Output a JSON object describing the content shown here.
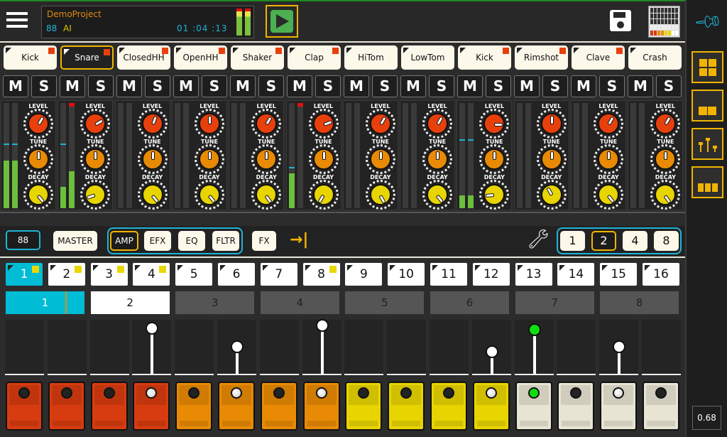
{
  "header": {
    "project": "DemoProject",
    "bpm": "88",
    "kit": "AI",
    "time": "01  :04  :13",
    "master_meter": [
      0.85,
      0.85
    ]
  },
  "tracks": [
    {
      "name": "Kick",
      "mark": true
    },
    {
      "name": "Snare",
      "mark": true,
      "selected": true
    },
    {
      "name": "ClosedHH",
      "mark": true
    },
    {
      "name": "OpenHH",
      "mark": true
    },
    {
      "name": "Shaker",
      "mark": true
    },
    {
      "name": "Clap",
      "mark": true
    },
    {
      "name": "HiTom",
      "mark": false
    },
    {
      "name": "LowTom",
      "mark": false
    },
    {
      "name": "Kick",
      "mark": true
    },
    {
      "name": "Rimshot",
      "mark": true
    },
    {
      "name": "Clave",
      "mark": true
    },
    {
      "name": "Crash",
      "mark": false
    }
  ],
  "mute_label": "M",
  "solo_label": "S",
  "knob_labels": [
    "LEVEL",
    "TUNE",
    "DECAY"
  ],
  "mixer": [
    {
      "meters": [
        0.45,
        0.45
      ],
      "peaks": [
        0.6,
        0.6
      ],
      "clip": false,
      "knobs": [
        30,
        0,
        140
      ]
    },
    {
      "meters": [
        0.2,
        0.35
      ],
      "peaks": [
        0.6,
        0.98
      ],
      "clip": true,
      "knobs": [
        60,
        0,
        -110
      ]
    },
    {
      "meters": [
        0,
        0
      ],
      "peaks": [
        null,
        null
      ],
      "clip": false,
      "knobs": [
        20,
        0,
        140
      ]
    },
    {
      "meters": [
        0,
        0
      ],
      "peaks": [
        null,
        null
      ],
      "clip": false,
      "knobs": [
        0,
        0,
        140
      ]
    },
    {
      "meters": [
        0,
        0
      ],
      "peaks": [
        null,
        null
      ],
      "clip": false,
      "knobs": [
        30,
        0,
        145
      ]
    },
    {
      "meters": [
        0.33,
        0
      ],
      "peaks": [
        0.38,
        null
      ],
      "clip": true,
      "knobs": [
        70,
        0,
        -150
      ]
    },
    {
      "meters": [
        0,
        0
      ],
      "peaks": [
        null,
        null
      ],
      "clip": false,
      "knobs": [
        30,
        0,
        150
      ]
    },
    {
      "meters": [
        0,
        0
      ],
      "peaks": [
        null,
        null
      ],
      "clip": false,
      "knobs": [
        30,
        0,
        140
      ]
    },
    {
      "meters": [
        0.12,
        0.12
      ],
      "peaks": [
        0.64,
        0.64
      ],
      "clip": false,
      "knobs": [
        90,
        0,
        -95
      ]
    },
    {
      "meters": [
        0,
        0
      ],
      "peaks": [
        null,
        null
      ],
      "clip": false,
      "knobs": [
        0,
        0,
        -30
      ]
    },
    {
      "meters": [
        0,
        0
      ],
      "peaks": [
        null,
        null
      ],
      "clip": false,
      "knobs": [
        30,
        0,
        140
      ]
    },
    {
      "meters": [
        0,
        0
      ],
      "peaks": [
        null,
        null
      ],
      "clip": false,
      "knobs": [
        30,
        0,
        145
      ]
    }
  ],
  "toolbar": {
    "bpm": "88",
    "master": "MASTER",
    "amp": "AMP",
    "efx": "EFX",
    "eq": "EQ",
    "fltr": "FLTR",
    "fx": "FX",
    "scales": [
      "1",
      "2",
      "4",
      "8"
    ],
    "selected_scale": "2"
  },
  "steps": [
    {
      "n": "1",
      "on": true,
      "mark": true
    },
    {
      "n": "2",
      "mark": true
    },
    {
      "n": "3",
      "mark": true
    },
    {
      "n": "4",
      "mark": true
    },
    {
      "n": "5"
    },
    {
      "n": "6"
    },
    {
      "n": "7"
    },
    {
      "n": "8",
      "mark": true
    },
    {
      "n": "9"
    },
    {
      "n": "10"
    },
    {
      "n": "11"
    },
    {
      "n": "12"
    },
    {
      "n": "13"
    },
    {
      "n": "14"
    },
    {
      "n": "15"
    },
    {
      "n": "16"
    }
  ],
  "patterns": [
    "1",
    "2",
    "3",
    "4",
    "5",
    "6",
    "7",
    "8"
  ],
  "velocities": [
    0,
    0,
    0,
    0.78,
    0,
    0.43,
    0,
    0.83,
    0,
    0,
    0,
    0.34,
    0.75,
    0,
    0.43,
    0
  ],
  "current_step": 13,
  "pad_colors": [
    "#d63c10",
    "#d63c10",
    "#d63c10",
    "#d63c10",
    "#e88a04",
    "#e88a04",
    "#e88a04",
    "#e88a04",
    "#e8d400",
    "#e8d400",
    "#e8d400",
    "#e8d400",
    "#e8e4d4",
    "#e8e4d4",
    "#e8e4d4",
    "#e8e4d4"
  ],
  "sidebar": {
    "value": "0.68"
  }
}
